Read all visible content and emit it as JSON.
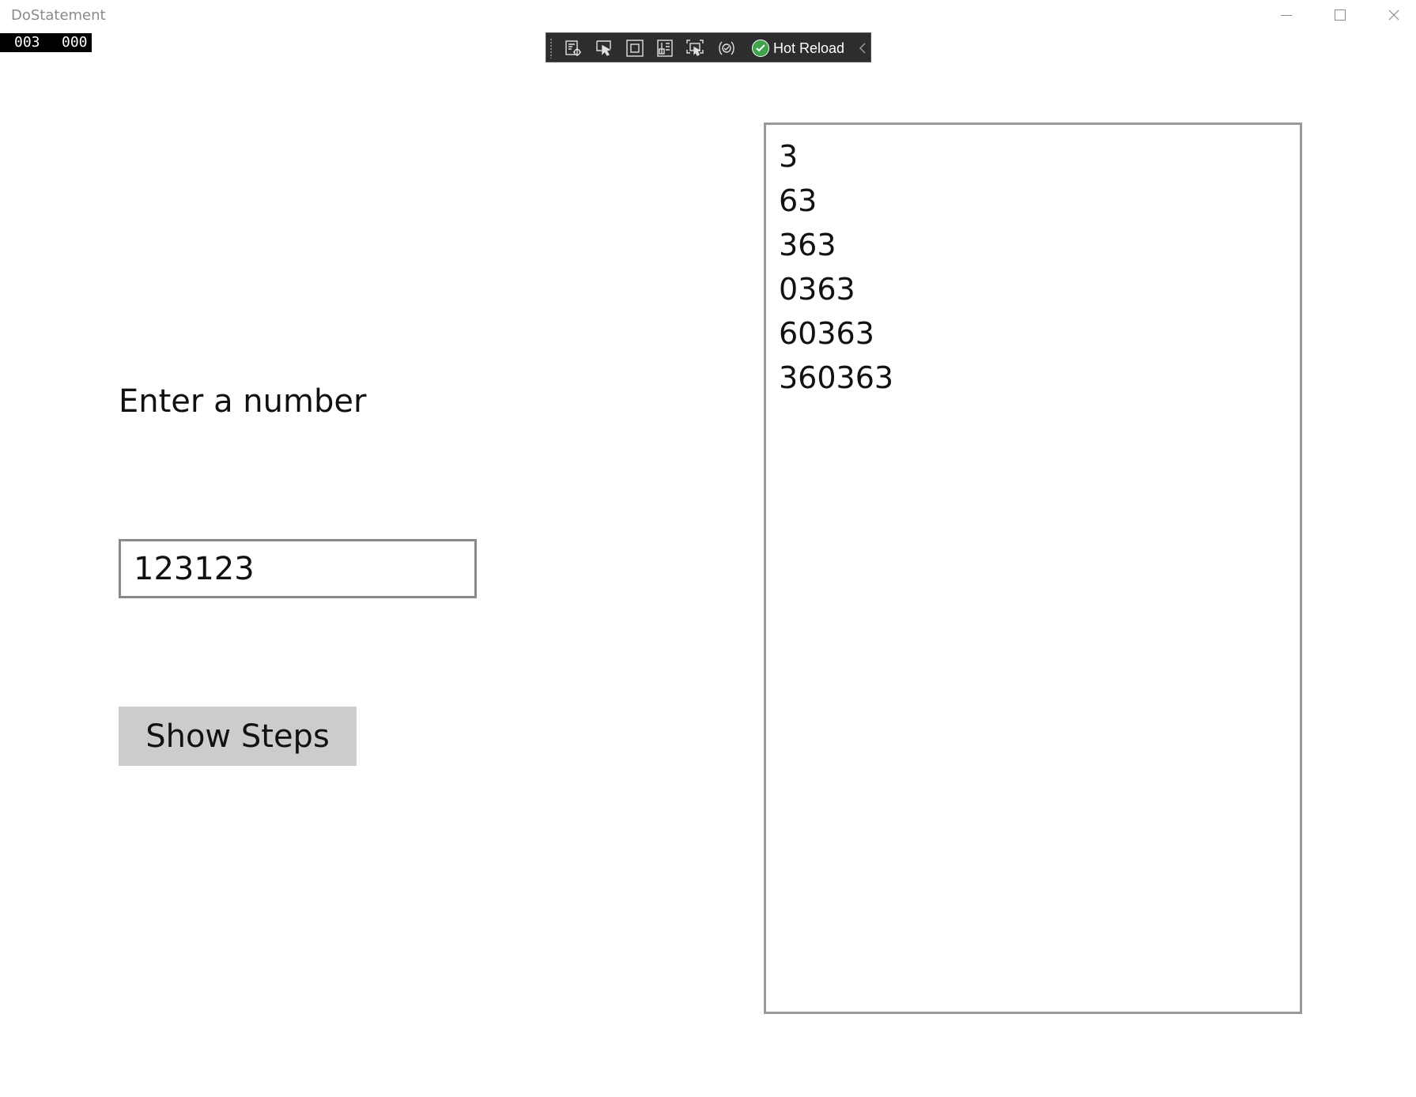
{
  "window": {
    "title": "DoStatement",
    "controls": {
      "minimize": "minimize-icon",
      "maximize": "maximize-icon",
      "close": "close-icon"
    }
  },
  "frame_counter": {
    "left": "003",
    "right": "000"
  },
  "debug_toolbar": {
    "icons": [
      "go-to-live-visual-tree-icon",
      "select-element-icon",
      "display-layout-adorners-icon",
      "track-focused-element-icon",
      "display-accessibility-icon",
      "binding-failures-icon"
    ],
    "hot_reload_label": "Hot Reload",
    "hot_reload_status": "ok",
    "accent": "#3fa34d"
  },
  "form": {
    "prompt": "Enter a number",
    "input_value": "123123",
    "button_label": "Show Steps"
  },
  "steps": {
    "lines": [
      "3",
      "63",
      "363",
      "0363",
      "60363",
      "360363"
    ]
  },
  "colors": {
    "button_bg": "#cccccc",
    "border": "#8a8a8a",
    "toolbar_bg": "#2d2d30"
  }
}
